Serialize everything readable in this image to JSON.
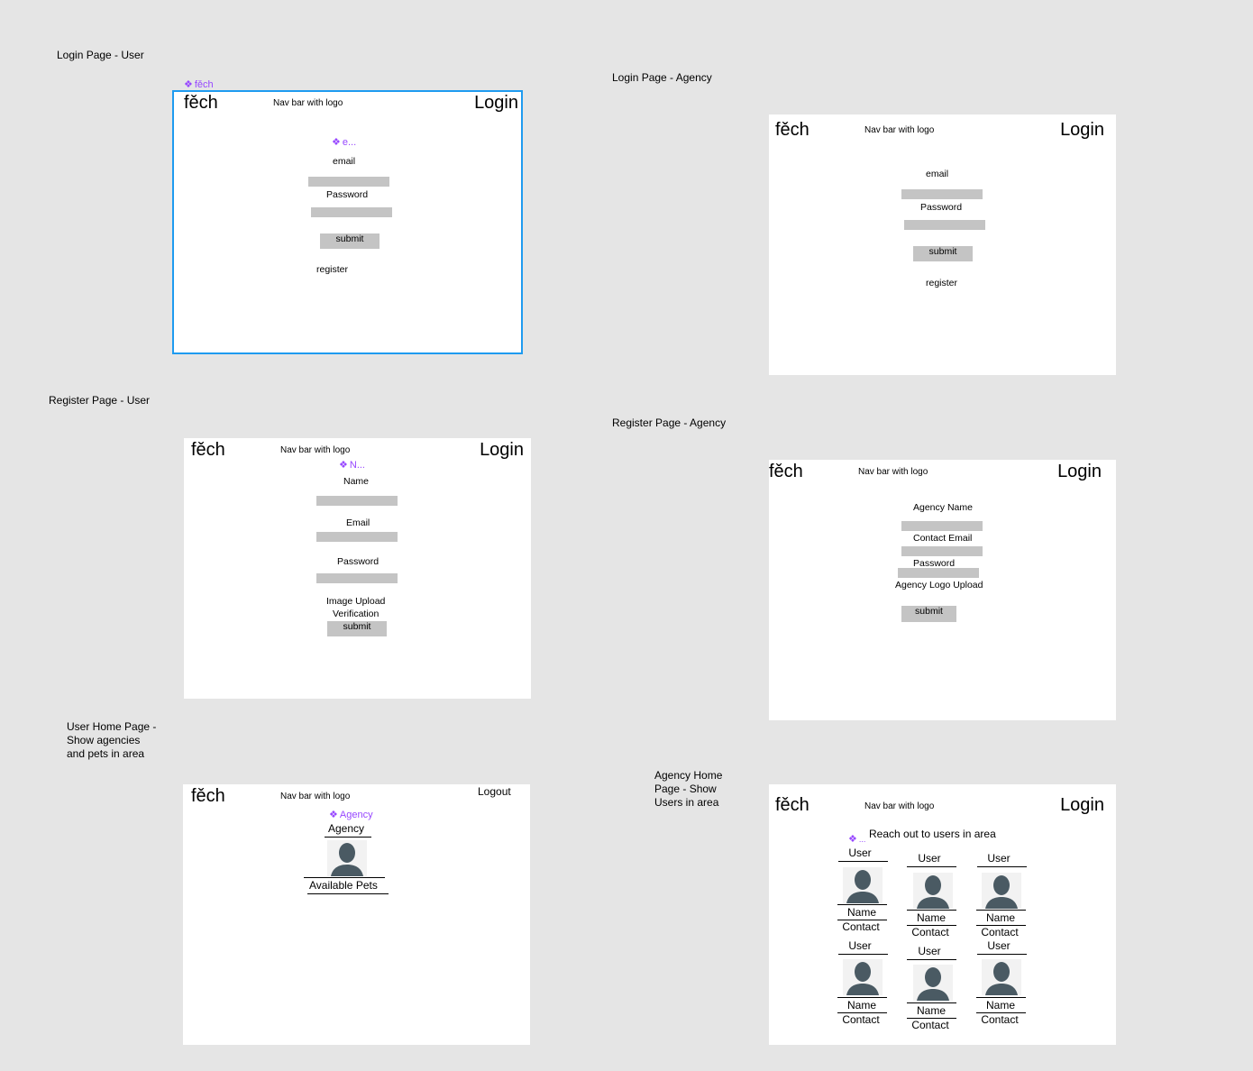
{
  "canvas": {
    "labels": {
      "login_user": "Login Page - User",
      "login_agency": "Login Page - Agency",
      "register_user": "Register Page - User",
      "register_agency": "Register Page - Agency",
      "user_home": "User Home Page -\nShow agencies\nand pets in area",
      "agency_home": "Agency Home\nPage - Show\nUsers in area"
    }
  },
  "common": {
    "logo": "fěch",
    "nav": "Nav bar with logo",
    "login": "Login",
    "logout": "Logout",
    "submit": "submit",
    "register": "register"
  },
  "login_user": {
    "component_tag_logo": "fěch",
    "component_tag_email": "e...",
    "email_label": "email",
    "password_label": "Password"
  },
  "login_agency": {
    "email_label": "email",
    "password_label": "Password"
  },
  "register_user": {
    "component_tag": "N...",
    "name_label": "Name",
    "email_label": "Email",
    "password_label": "Password",
    "image_upload": "Image Upload",
    "verification": "Verification"
  },
  "register_agency": {
    "agency_name": "Agency Name",
    "contact_email": "Contact Email",
    "password": "Password",
    "logo_upload": "Agency Logo Upload"
  },
  "user_home": {
    "component_tag": "Agency",
    "agency_label": "Agency",
    "available_pets": "Available Pets"
  },
  "agency_home": {
    "component_tag": "...",
    "heading": "Reach out to users in area",
    "cards": [
      {
        "title": "User",
        "name": "Name",
        "contact": "Contact"
      },
      {
        "title": "User",
        "name": "Name",
        "contact": "Contact"
      },
      {
        "title": "User",
        "name": "Name",
        "contact": "Contact"
      },
      {
        "title": "User",
        "name": "Name",
        "contact": "Contact"
      },
      {
        "title": "User",
        "name": "Name",
        "contact": "Contact"
      },
      {
        "title": "User",
        "name": "Name",
        "contact": "Contact"
      }
    ]
  }
}
